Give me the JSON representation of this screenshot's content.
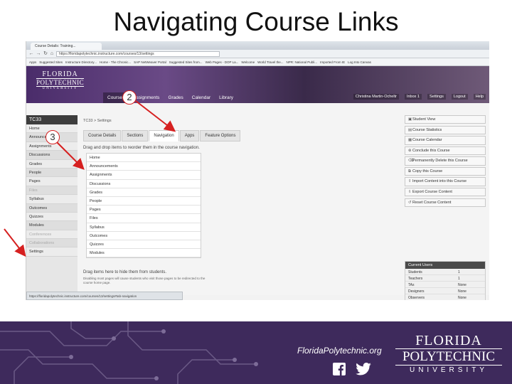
{
  "slide": {
    "title": "Navigating Course Links"
  },
  "browser": {
    "tab_title": "Course Details: Training...",
    "url": "https://floridapolytechnic.instructure.com/courses/13/settings",
    "bookmarks": [
      "Apps",
      "Suggested Sites",
      "Instructure Directory...",
      "Home - The Chronic...",
      "SAP NetWeaver Portal",
      "Suggested Sites from...",
      "Web Pages - DOP La...",
      "Welcome",
      "World Travel the...",
      "NPR: National Publi...",
      "Imported From IE",
      "Log Into Canvas"
    ],
    "status_url": "https://floridapolytechnic.instructure.com/courses/13/settings#tab-navigation"
  },
  "header": {
    "logo": {
      "line1": "FLORIDA",
      "line2": "POLYTECHNIC",
      "line3": "UNIVERSITY"
    },
    "user_name": "Christina Martin-Ocheltr",
    "user_links": [
      "Inbox 1",
      "Settings",
      "Logout",
      "Help"
    ],
    "global_nav": [
      "Courses",
      "Assignments",
      "Grades",
      "Calendar",
      "Library"
    ]
  },
  "sidenav": {
    "course": "TC33",
    "items": [
      "Home",
      "Announcements",
      "Assignments",
      "Discussions",
      "Grades",
      "People",
      "Pages",
      "Files",
      "Syllabus",
      "Outcomes",
      "Quizzes",
      "Modules",
      "Conferences",
      "Collaborations",
      "Settings"
    ]
  },
  "content": {
    "breadcrumb": "TC33 > Settings",
    "tabs": [
      "Course Details",
      "Sections",
      "Navigation",
      "Apps",
      "Feature Options"
    ],
    "instruction": "Drag and drop items to reorder them in the course navigation.",
    "links": [
      "Home",
      "Announcements",
      "Assignments",
      "Discussions",
      "Grades",
      "People",
      "Pages",
      "Files",
      "Syllabus",
      "Outcomes",
      "Quizzes",
      "Modules"
    ],
    "hide_instruction": "Drag items here to hide them from students.",
    "hide_note": "Disabling most pages will cause students who visit those pages to be redirected to the course home page."
  },
  "right": {
    "buttons": [
      {
        "icon": "▣",
        "label": "Student View"
      },
      {
        "icon": "▤",
        "label": "Course Statistics"
      },
      {
        "icon": "▦",
        "label": "Course Calendar"
      },
      {
        "icon": "⊗",
        "label": "Conclude this Course"
      },
      {
        "icon": "⌫",
        "label": "Permanently Delete this Course"
      },
      {
        "icon": "⧉",
        "label": "Copy this Course"
      },
      {
        "icon": "⇪",
        "label": "Import Content into this Course"
      },
      {
        "icon": "⇩",
        "label": "Export Course Content"
      },
      {
        "icon": "↺",
        "label": "Reset Course Content"
      }
    ],
    "users_title": "Current Users",
    "users": [
      {
        "role": "Students",
        "count": "1"
      },
      {
        "role": "Teachers",
        "count": "1"
      },
      {
        "role": "TAs",
        "count": "None"
      },
      {
        "role": "Designers",
        "count": "None"
      },
      {
        "role": "Observers",
        "count": "None"
      }
    ]
  },
  "callouts": {
    "two": "2",
    "three": "3"
  },
  "footer": {
    "url": "FloridaPolytechnic.org",
    "logo": {
      "line1": "FLORIDA",
      "line2": "POLYTECHNIC",
      "line3": "UNIVERSITY"
    }
  },
  "colors": {
    "brand_purple": "#3e2a5c",
    "callout_red": "#d62020"
  }
}
